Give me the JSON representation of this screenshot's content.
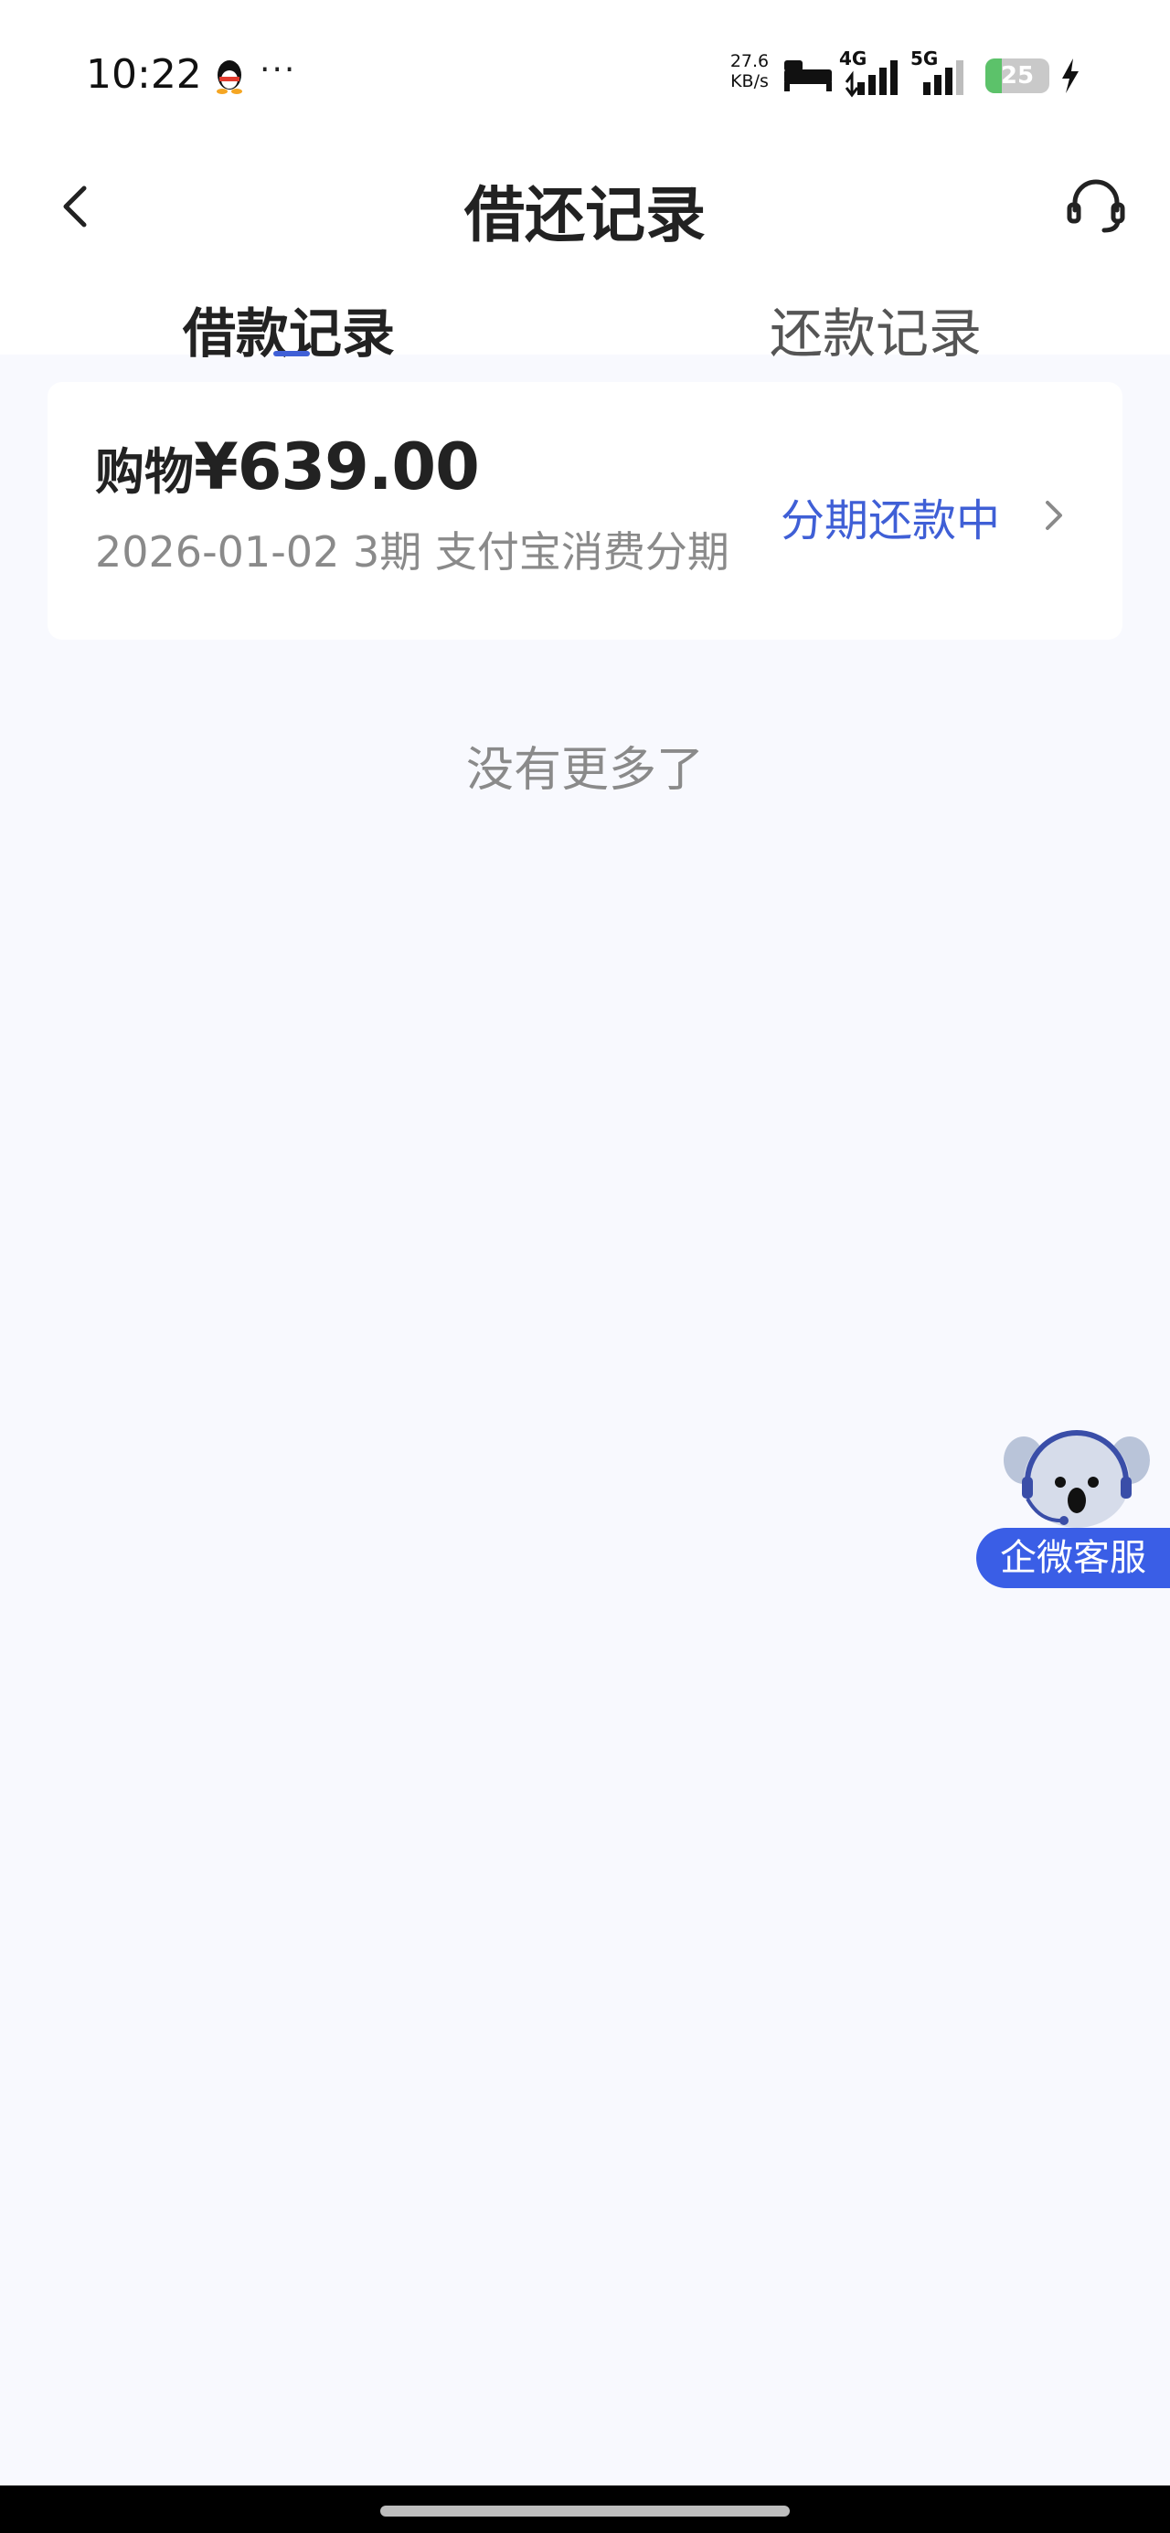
{
  "status_bar": {
    "time": "10:22",
    "more": "···",
    "net_speed_value": "27.6",
    "net_speed_unit": "KB/s",
    "signal_1_label": "4G",
    "signal_2_label": "5G",
    "battery_level": "25",
    "battery_fraction": 0.25,
    "battery_color": "#5cc26a",
    "icons": [
      "qq-icon",
      "bed-icon",
      "signal-4g-icon",
      "signal-5g-icon",
      "battery-icon",
      "charging-bolt-icon"
    ]
  },
  "nav": {
    "title": "借还记录",
    "back_icon": "chevron-left-icon",
    "service_icon": "headset-icon"
  },
  "tabs": [
    {
      "label": "借款记录",
      "active": true
    },
    {
      "label": "还款记录",
      "active": false
    }
  ],
  "records": [
    {
      "type": "购物",
      "amount": "¥639.00",
      "detail": "2026-01-02 3期  支付宝消费分期",
      "status": "分期还款中"
    }
  ],
  "list_end_text": "没有更多了",
  "float_service": {
    "label": "企微客服",
    "icon": "koala-headset-icon"
  },
  "colors": {
    "accent": "#3f5fd6",
    "service_button": "#3a5ee6",
    "page_background": "#f8f9fe"
  }
}
